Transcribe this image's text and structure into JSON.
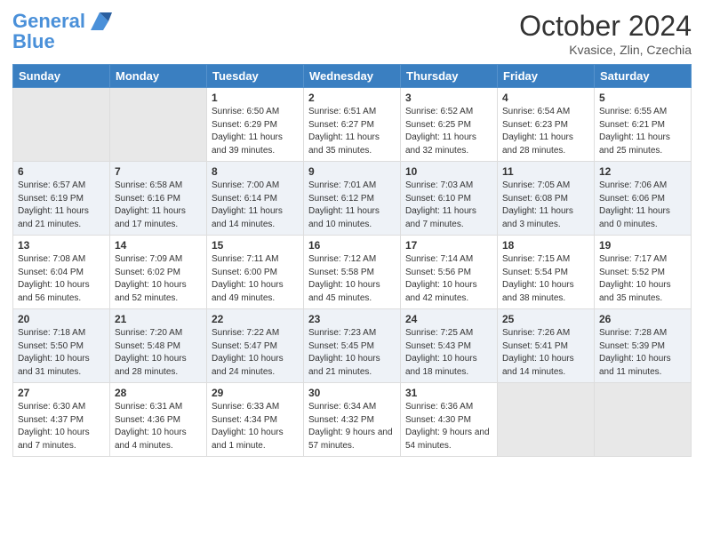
{
  "header": {
    "logo_line1": "General",
    "logo_line2": "Blue",
    "month_title": "October 2024",
    "location": "Kvasice, Zlin, Czechia"
  },
  "days_of_week": [
    "Sunday",
    "Monday",
    "Tuesday",
    "Wednesday",
    "Thursday",
    "Friday",
    "Saturday"
  ],
  "weeks": [
    [
      {
        "day": "",
        "empty": true
      },
      {
        "day": "",
        "empty": true
      },
      {
        "day": "1",
        "sunrise": "6:50 AM",
        "sunset": "6:29 PM",
        "daylight": "11 hours and 39 minutes."
      },
      {
        "day": "2",
        "sunrise": "6:51 AM",
        "sunset": "6:27 PM",
        "daylight": "11 hours and 35 minutes."
      },
      {
        "day": "3",
        "sunrise": "6:52 AM",
        "sunset": "6:25 PM",
        "daylight": "11 hours and 32 minutes."
      },
      {
        "day": "4",
        "sunrise": "6:54 AM",
        "sunset": "6:23 PM",
        "daylight": "11 hours and 28 minutes."
      },
      {
        "day": "5",
        "sunrise": "6:55 AM",
        "sunset": "6:21 PM",
        "daylight": "11 hours and 25 minutes."
      }
    ],
    [
      {
        "day": "6",
        "sunrise": "6:57 AM",
        "sunset": "6:19 PM",
        "daylight": "11 hours and 21 minutes."
      },
      {
        "day": "7",
        "sunrise": "6:58 AM",
        "sunset": "6:16 PM",
        "daylight": "11 hours and 17 minutes."
      },
      {
        "day": "8",
        "sunrise": "7:00 AM",
        "sunset": "6:14 PM",
        "daylight": "11 hours and 14 minutes."
      },
      {
        "day": "9",
        "sunrise": "7:01 AM",
        "sunset": "6:12 PM",
        "daylight": "11 hours and 10 minutes."
      },
      {
        "day": "10",
        "sunrise": "7:03 AM",
        "sunset": "6:10 PM",
        "daylight": "11 hours and 7 minutes."
      },
      {
        "day": "11",
        "sunrise": "7:05 AM",
        "sunset": "6:08 PM",
        "daylight": "11 hours and 3 minutes."
      },
      {
        "day": "12",
        "sunrise": "7:06 AM",
        "sunset": "6:06 PM",
        "daylight": "11 hours and 0 minutes."
      }
    ],
    [
      {
        "day": "13",
        "sunrise": "7:08 AM",
        "sunset": "6:04 PM",
        "daylight": "10 hours and 56 minutes."
      },
      {
        "day": "14",
        "sunrise": "7:09 AM",
        "sunset": "6:02 PM",
        "daylight": "10 hours and 52 minutes."
      },
      {
        "day": "15",
        "sunrise": "7:11 AM",
        "sunset": "6:00 PM",
        "daylight": "10 hours and 49 minutes."
      },
      {
        "day": "16",
        "sunrise": "7:12 AM",
        "sunset": "5:58 PM",
        "daylight": "10 hours and 45 minutes."
      },
      {
        "day": "17",
        "sunrise": "7:14 AM",
        "sunset": "5:56 PM",
        "daylight": "10 hours and 42 minutes."
      },
      {
        "day": "18",
        "sunrise": "7:15 AM",
        "sunset": "5:54 PM",
        "daylight": "10 hours and 38 minutes."
      },
      {
        "day": "19",
        "sunrise": "7:17 AM",
        "sunset": "5:52 PM",
        "daylight": "10 hours and 35 minutes."
      }
    ],
    [
      {
        "day": "20",
        "sunrise": "7:18 AM",
        "sunset": "5:50 PM",
        "daylight": "10 hours and 31 minutes."
      },
      {
        "day": "21",
        "sunrise": "7:20 AM",
        "sunset": "5:48 PM",
        "daylight": "10 hours and 28 minutes."
      },
      {
        "day": "22",
        "sunrise": "7:22 AM",
        "sunset": "5:47 PM",
        "daylight": "10 hours and 24 minutes."
      },
      {
        "day": "23",
        "sunrise": "7:23 AM",
        "sunset": "5:45 PM",
        "daylight": "10 hours and 21 minutes."
      },
      {
        "day": "24",
        "sunrise": "7:25 AM",
        "sunset": "5:43 PM",
        "daylight": "10 hours and 18 minutes."
      },
      {
        "day": "25",
        "sunrise": "7:26 AM",
        "sunset": "5:41 PM",
        "daylight": "10 hours and 14 minutes."
      },
      {
        "day": "26",
        "sunrise": "7:28 AM",
        "sunset": "5:39 PM",
        "daylight": "10 hours and 11 minutes."
      }
    ],
    [
      {
        "day": "27",
        "sunrise": "6:30 AM",
        "sunset": "4:37 PM",
        "daylight": "10 hours and 7 minutes."
      },
      {
        "day": "28",
        "sunrise": "6:31 AM",
        "sunset": "4:36 PM",
        "daylight": "10 hours and 4 minutes."
      },
      {
        "day": "29",
        "sunrise": "6:33 AM",
        "sunset": "4:34 PM",
        "daylight": "10 hours and 1 minute."
      },
      {
        "day": "30",
        "sunrise": "6:34 AM",
        "sunset": "4:32 PM",
        "daylight": "9 hours and 57 minutes."
      },
      {
        "day": "31",
        "sunrise": "6:36 AM",
        "sunset": "4:30 PM",
        "daylight": "9 hours and 54 minutes."
      },
      {
        "day": "",
        "empty": true
      },
      {
        "day": "",
        "empty": true
      }
    ]
  ],
  "labels": {
    "sunrise": "Sunrise:",
    "sunset": "Sunset:",
    "daylight": "Daylight:"
  }
}
